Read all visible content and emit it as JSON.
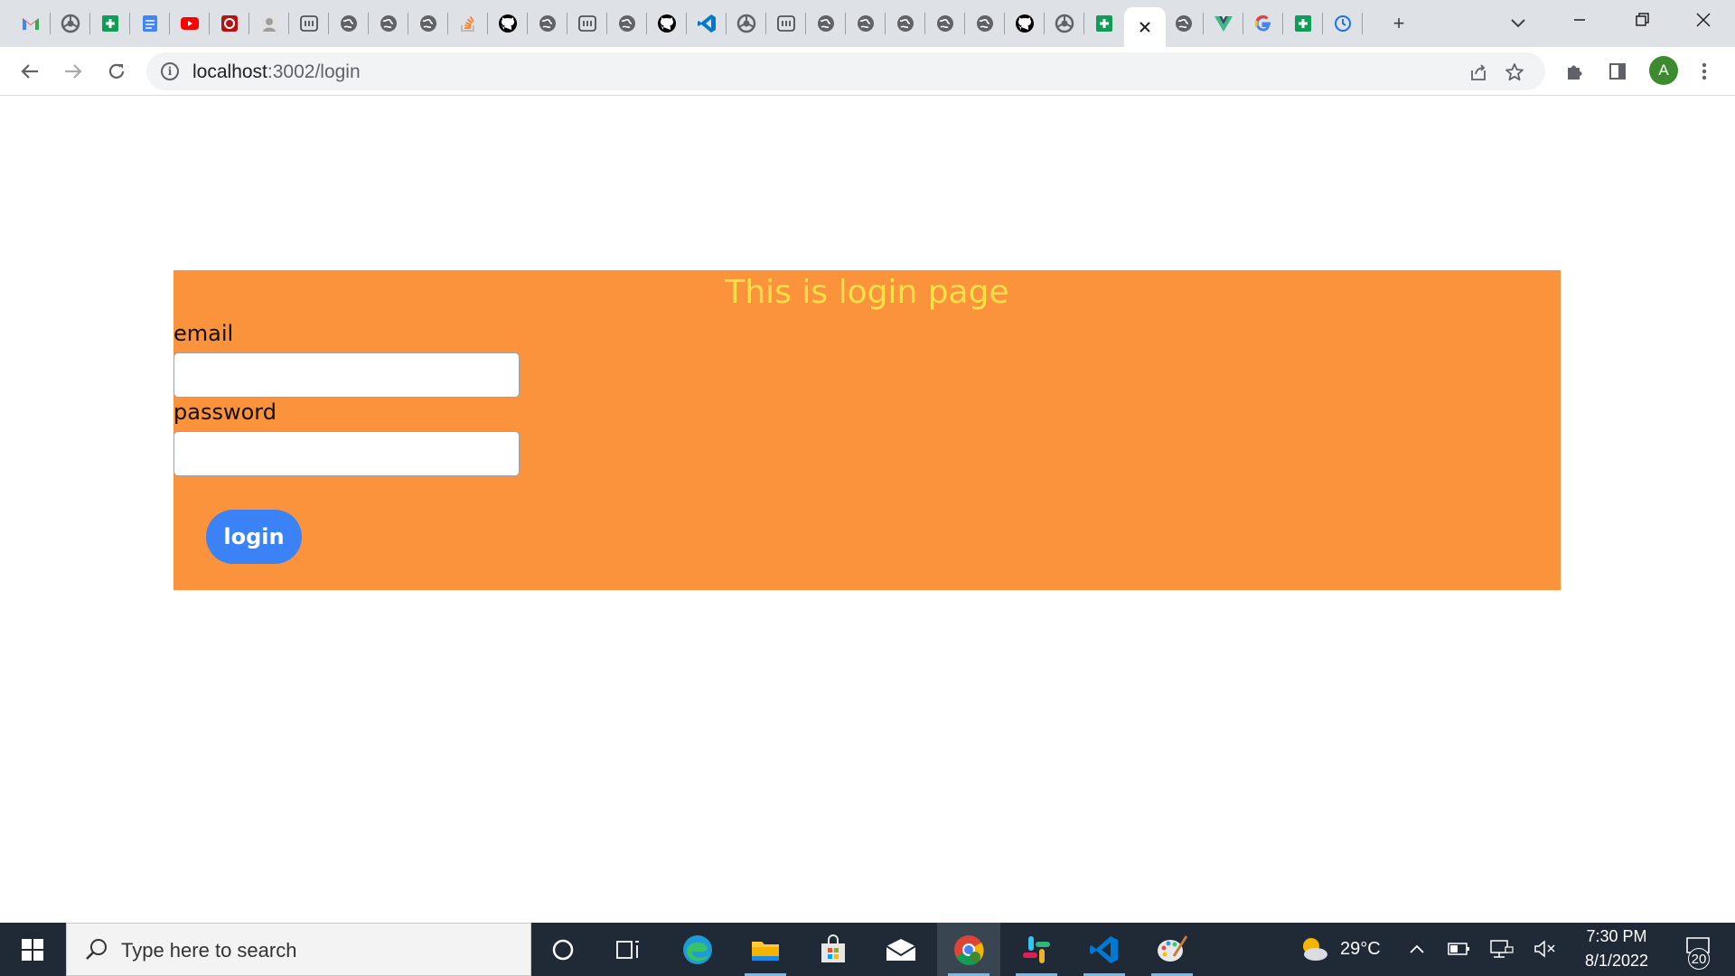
{
  "browser": {
    "tabs": [
      {
        "icon": "gmail-icon",
        "color": "#ea4335"
      },
      {
        "icon": "chromium-icon",
        "color": "#5f6368"
      },
      {
        "icon": "sheets-icon",
        "color": "#0f9d58"
      },
      {
        "icon": "docs-icon",
        "color": "#4285f4"
      },
      {
        "icon": "youtube-icon",
        "color": "#ff0000"
      },
      {
        "icon": "red-app-icon",
        "color": "#b31412"
      },
      {
        "icon": "profile-photo-icon",
        "color": "#9e9e9e"
      },
      {
        "icon": "dev-icon",
        "color": "#3c4043"
      },
      {
        "icon": "globe-icon",
        "color": "#5f6368"
      },
      {
        "icon": "globe-icon",
        "color": "#5f6368"
      },
      {
        "icon": "globe-icon",
        "color": "#5f6368"
      },
      {
        "icon": "stackoverflow-icon",
        "color": "#f48024"
      },
      {
        "icon": "github-icon",
        "color": "#000000"
      },
      {
        "icon": "globe-icon",
        "color": "#5f6368"
      },
      {
        "icon": "dev-icon",
        "color": "#3c4043"
      },
      {
        "icon": "globe-icon",
        "color": "#5f6368"
      },
      {
        "icon": "github-icon",
        "color": "#000000"
      },
      {
        "icon": "vscode-icon",
        "color": "#007acc"
      },
      {
        "icon": "chromium-icon",
        "color": "#5f6368"
      },
      {
        "icon": "dev-icon",
        "color": "#3c4043"
      },
      {
        "icon": "globe-icon",
        "color": "#5f6368"
      },
      {
        "icon": "globe-icon",
        "color": "#5f6368"
      },
      {
        "icon": "globe-icon",
        "color": "#5f6368"
      },
      {
        "icon": "globe-icon",
        "color": "#5f6368"
      },
      {
        "icon": "globe-icon",
        "color": "#5f6368"
      },
      {
        "icon": "github-icon",
        "color": "#000000"
      },
      {
        "icon": "chromium-icon",
        "color": "#5f6368"
      },
      {
        "icon": "sheets-icon",
        "color": "#0f9d58"
      },
      {
        "icon": "close-icon",
        "color": "#202124",
        "active": true
      },
      {
        "icon": "globe-icon",
        "color": "#5f6368"
      },
      {
        "icon": "vue-icon",
        "color": "#41b883"
      },
      {
        "icon": "google-icon",
        "color": "#4285f4"
      },
      {
        "icon": "sheets-icon",
        "color": "#0f9d58"
      },
      {
        "icon": "history-icon",
        "color": "#1a73e8"
      }
    ],
    "new_tab_label": "+",
    "address": {
      "host": "localhost",
      "path": ":3002/login"
    },
    "profile_initial": "A"
  },
  "login": {
    "title": "This is login page",
    "email_label": "email",
    "email_value": "",
    "password_label": "password",
    "password_value": "",
    "button_label": "login",
    "panel_color": "#fb923c",
    "title_color": "#fde047",
    "button_color": "#3b82f6"
  },
  "taskbar": {
    "search_placeholder": "Type here to search",
    "weather_temp": "29°C",
    "time": "7:30 PM",
    "date": "8/1/2022",
    "notification_count": "20"
  }
}
